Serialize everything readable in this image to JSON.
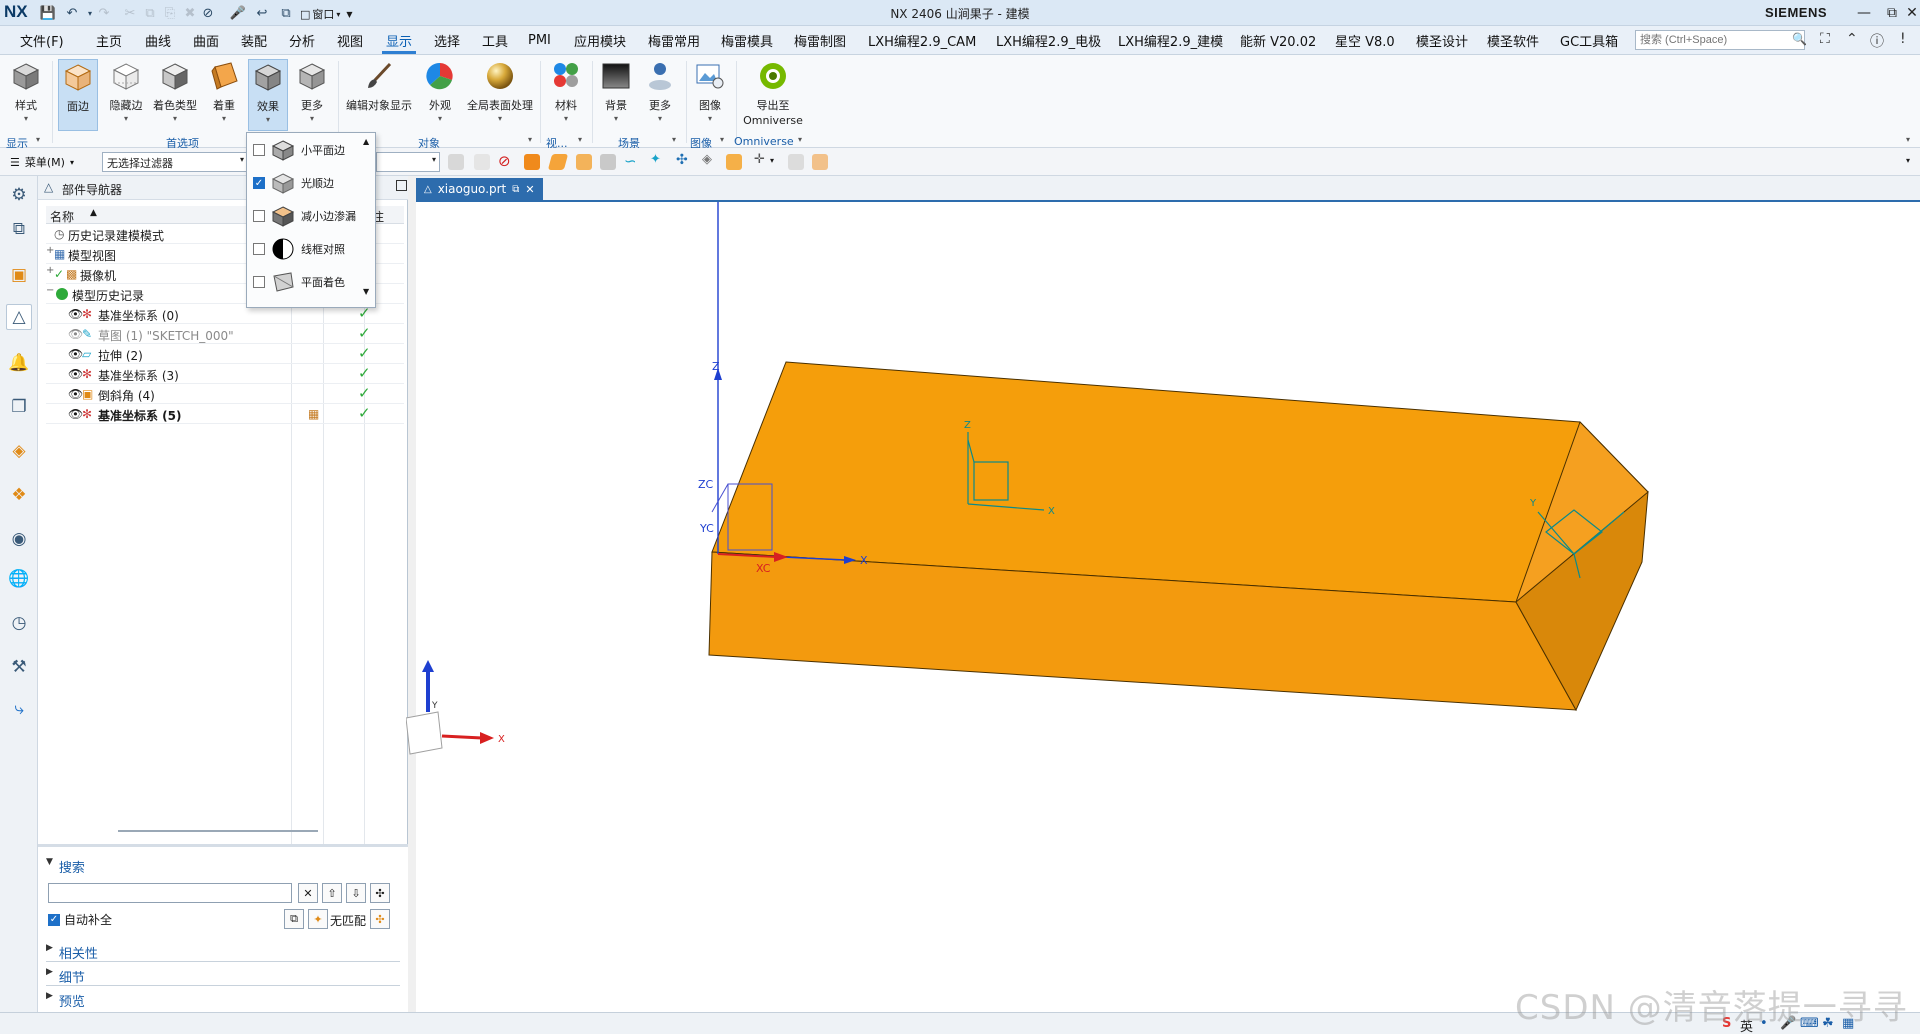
{
  "titlebar": {
    "logo": "NX",
    "window_menu": "窗口",
    "title": "NX 2406 山涧果子 - 建模",
    "brand": "SIEMENS"
  },
  "menu": {
    "file": "文件(F)",
    "tabs": [
      "主页",
      "曲线",
      "曲面",
      "装配",
      "分析",
      "视图",
      "显示",
      "选择",
      "工具",
      "PMI",
      "应用模块",
      "梅雷常用",
      "梅雷模具",
      "梅雷制图",
      "LXH编程2.9_CAM",
      "LXH编程2.9_电极",
      "LXH编程2.9_建模",
      "能新 V20.02",
      "星空 V8.0",
      "模圣设计",
      "模圣软件",
      "GC工具箱"
    ],
    "active_tab": "显示",
    "search_placeholder": "搜索 (Ctrl+Space)"
  },
  "ribbon": {
    "buttons": [
      "样式",
      "面边",
      "隐藏边",
      "着色类型",
      "着重",
      "效果",
      "更多",
      "编辑对象显示",
      "外观",
      "全局表面处理",
      "材料",
      "背景",
      "更多",
      "图像",
      "导出至",
      "Omniverse"
    ],
    "groups": [
      "显示",
      "首选项",
      "对象",
      "视...",
      "场景",
      "图像",
      "Omniverse"
    ]
  },
  "selection_bar": {
    "menu_label": "菜单(M)",
    "filter": "无选择过滤器"
  },
  "effects_menu": {
    "items": [
      {
        "label": "小平面边",
        "checked": false
      },
      {
        "label": "光顺边",
        "checked": true
      },
      {
        "label": "减小边渗漏",
        "checked": false
      },
      {
        "label": "线框对照",
        "checked": false
      },
      {
        "label": "平面着色",
        "checked": false
      }
    ]
  },
  "navigator": {
    "title": "部件导航器",
    "col_name": "名称",
    "col_note": "附注",
    "rows": [
      {
        "label": "历史记录建模模式"
      },
      {
        "label": "模型视图"
      },
      {
        "label": "摄像机"
      },
      {
        "label": "模型历史记录"
      },
      {
        "label": "基准坐标系 (0)"
      },
      {
        "label": "草图 (1) \"SKETCH_000\""
      },
      {
        "label": "拉伸 (2)"
      },
      {
        "label": "基准坐标系 (3)"
      },
      {
        "label": "倒斜角 (4)"
      },
      {
        "label": "基准坐标系 (5)"
      }
    ],
    "search_title": "搜索",
    "auto_complete": "自动补全",
    "no_match": "无匹配",
    "sections": [
      "相关性",
      "细节",
      "预览"
    ]
  },
  "document": {
    "tab": "xiaoguo.prt"
  },
  "viewport": {
    "part_color": "#F59E0B",
    "axis_labels": [
      "Z",
      "ZC",
      "YC",
      "XC",
      "X",
      "Y"
    ]
  },
  "statusbar": {
    "watermark": "CSDN @清音落提一寻寻",
    "ime": "英"
  }
}
